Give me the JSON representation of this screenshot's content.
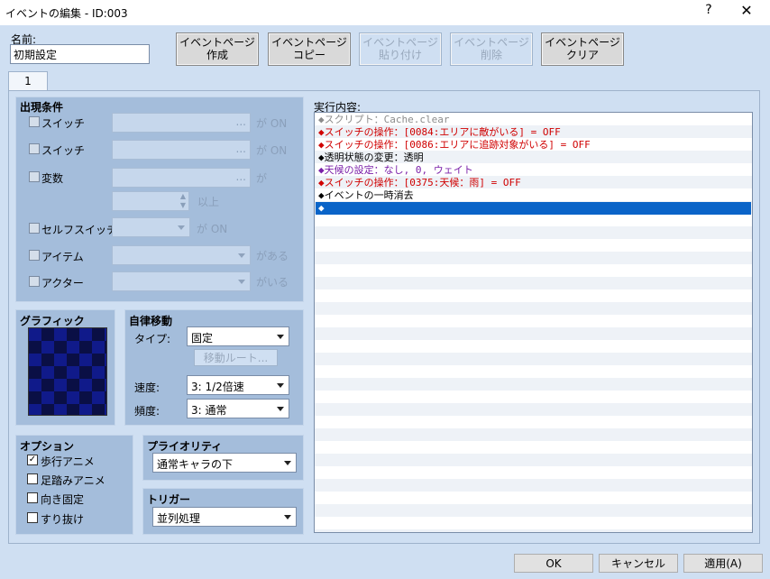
{
  "window": {
    "title": "イベントの編集 - ID:003",
    "help": "?",
    "close": "✕"
  },
  "name_label": "名前:",
  "name_value": "初期設定",
  "page_buttons": [
    {
      "l1": "イベントページ",
      "l2": "作成",
      "enabled": true
    },
    {
      "l1": "イベントページ",
      "l2": "コピー",
      "enabled": true
    },
    {
      "l1": "イベントページ",
      "l2": "貼り付け",
      "enabled": false
    },
    {
      "l1": "イベントページ",
      "l2": "削除",
      "enabled": false
    },
    {
      "l1": "イベントページ",
      "l2": "クリア",
      "enabled": true
    }
  ],
  "tab": "1",
  "conditions": {
    "title": "出現条件",
    "switch1": "スイッチ",
    "switch1_suffix": "が ON",
    "switch2": "スイッチ",
    "switch2_suffix": "が ON",
    "variable": "変数",
    "variable_suffix": "が",
    "variable_more": "以上",
    "self_switch": "セルフスイッチ",
    "self_suffix": "が ON",
    "item": "アイテム",
    "item_suffix": "がある",
    "actor": "アクター",
    "actor_suffix": "がいる",
    "ellipsis": "..."
  },
  "graphic": {
    "title": "グラフィック"
  },
  "autonomous": {
    "title": "自律移動",
    "type_label": "タイプ:",
    "type_value": "固定",
    "route_button": "移動ルート...",
    "speed_label": "速度:",
    "speed_value": "3: 1/2倍速",
    "freq_label": "頻度:",
    "freq_value": "3: 通常"
  },
  "options": {
    "title": "オプション",
    "items": [
      {
        "label": "歩行アニメ",
        "checked": true
      },
      {
        "label": "足踏みアニメ",
        "checked": false
      },
      {
        "label": "向き固定",
        "checked": false
      },
      {
        "label": "すり抜け",
        "checked": false
      }
    ]
  },
  "priority": {
    "title": "プライオリティ",
    "value": "通常キャラの下"
  },
  "trigger": {
    "title": "トリガー",
    "value": "並列処理"
  },
  "contents": {
    "label": "実行内容:",
    "rows": [
      {
        "text": "◆スクリプト：Cache.clear",
        "color": "#8c8c8c"
      },
      {
        "text": "◆スイッチの操作：[0084:エリアに敵がいる] = OFF",
        "color": "#d00000"
      },
      {
        "text": "◆スイッチの操作：[0086:エリアに追跡対象がいる] = OFF",
        "color": "#d00000"
      },
      {
        "text": "◆透明状態の変更：透明",
        "color": "#000000"
      },
      {
        "text": "◆天候の設定：なし, 0, ウェイト",
        "color": "#7a1fa8"
      },
      {
        "text": "◆スイッチの操作：[0375:天候：雨] = OFF",
        "color": "#d00000"
      },
      {
        "text": "◆イベントの一時消去",
        "color": "#000000"
      },
      {
        "text": "◆",
        "color": "#ffffff"
      }
    ],
    "selected_row": 7,
    "selection_color": "#0a64c8"
  },
  "footer": {
    "ok": "OK",
    "cancel": "キャンセル",
    "apply": "適用(A)"
  }
}
